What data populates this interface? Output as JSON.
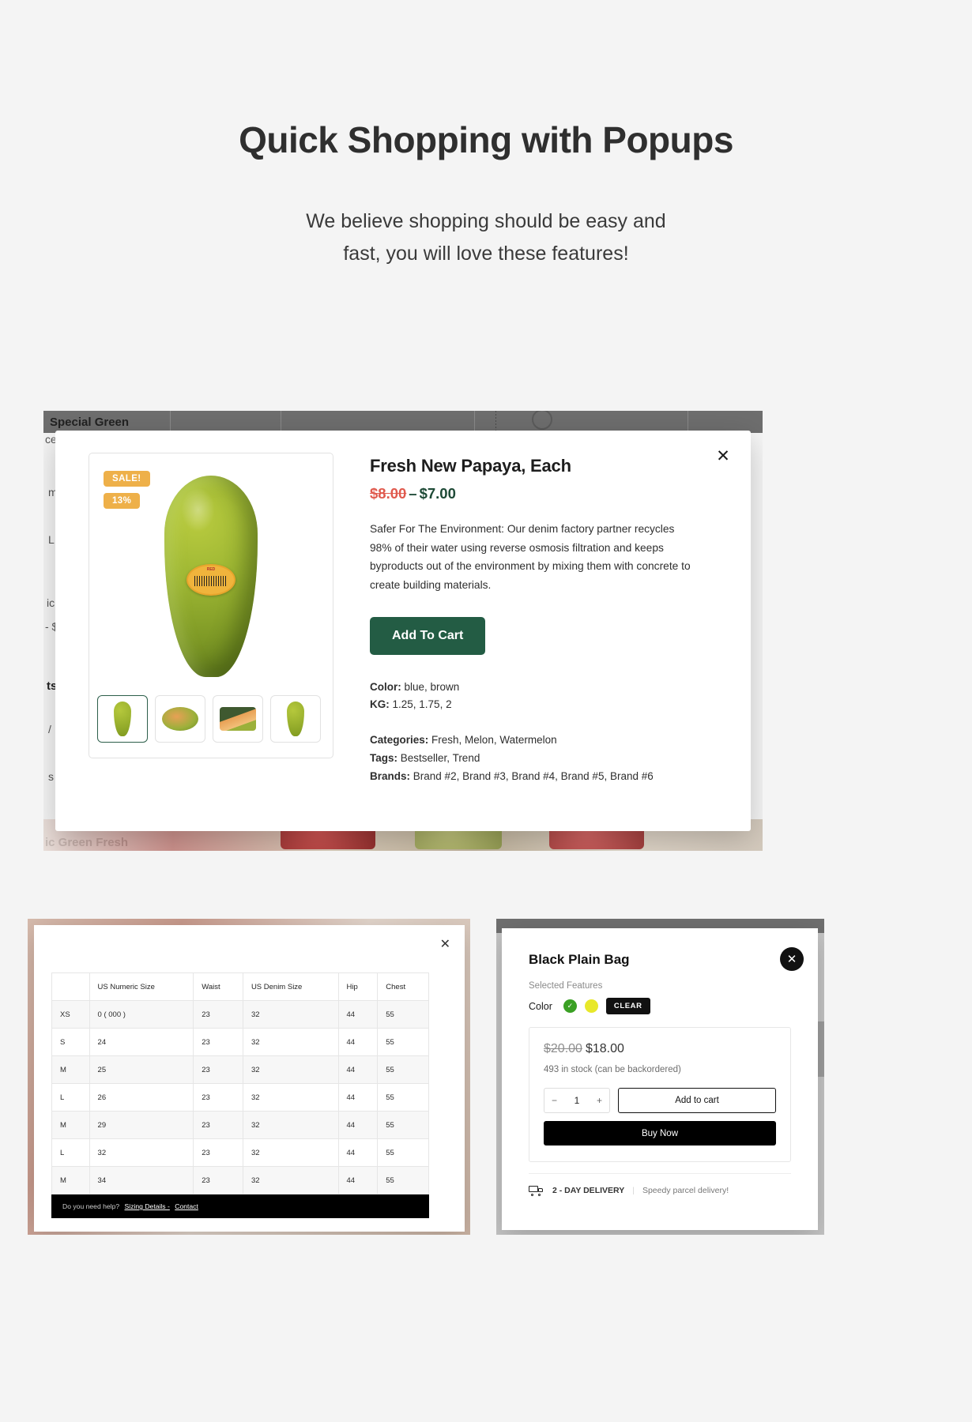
{
  "hero": {
    "title": "Quick Shopping with Popups",
    "subtitle_line1": "We believe shopping should be easy and",
    "subtitle_line2": "fast, you will love these features!"
  },
  "colors": {
    "accent_green": "#235c44",
    "sale_badge": "#eeb049",
    "old_price_red": "#e05a4e",
    "new_price_green": "#1e4a36",
    "black": "#000000"
  },
  "quick_view": {
    "close_label": "✕",
    "badges": {
      "sale": "SALE!",
      "discount": "13%"
    },
    "thumbnails": [
      {
        "name": "whole-papaya"
      },
      {
        "name": "cut-papaya"
      },
      {
        "name": "papaya-on-board"
      },
      {
        "name": "papaya-side"
      }
    ],
    "title": "Fresh New Papaya, Each",
    "price_old": "$8.00",
    "price_separator": "–",
    "price_new": "$7.00",
    "description": "Safer For The Environment: Our denim factory partner recycles 98% of their water using reverse osmosis filtration and keeps byproducts out of the environment by mixing them with concrete to create building materials.",
    "add_to_cart_label": "Add To Cart",
    "attributes": [
      {
        "label": "Color:",
        "value": "blue, brown"
      },
      {
        "label": "KG:",
        "value": "1.25, 1.75, 2"
      }
    ],
    "meta": [
      {
        "label": "Categories:",
        "value": "Fresh, Melon, Watermelon"
      },
      {
        "label": "Tags:",
        "value": "Bestseller, Trend"
      },
      {
        "label": "Brands:",
        "value": "Brand #2, Brand #3, Brand #4, Brand #5, Brand #6"
      }
    ],
    "background_texts": [
      "Special Green",
      "ce",
      "m",
      "L",
      "ic",
      "- $",
      "ts",
      "/",
      "s",
      "ic Green Fresh"
    ]
  },
  "size_chart": {
    "close_label": "✕",
    "columns": [
      "",
      "US Numeric Size",
      "Waist",
      "US Denim Size",
      "Hip",
      "Chest"
    ],
    "rows": [
      [
        "XS",
        "0 ( 000 )",
        "23",
        "32",
        "44",
        "55"
      ],
      [
        "S",
        "24",
        "23",
        "32",
        "44",
        "55"
      ],
      [
        "M",
        "25",
        "23",
        "32",
        "44",
        "55"
      ],
      [
        "L",
        "26",
        "23",
        "32",
        "44",
        "55"
      ],
      [
        "M",
        "29",
        "23",
        "32",
        "44",
        "55"
      ],
      [
        "L",
        "32",
        "23",
        "32",
        "44",
        "55"
      ],
      [
        "M",
        "34",
        "23",
        "32",
        "44",
        "55"
      ]
    ],
    "footer_text": "Do you need help?",
    "footer_link_1": "Sizing Details -",
    "footer_link_2": "Contact"
  },
  "bag_popup": {
    "close_label": "✕",
    "title": "Black Plain Bag",
    "selected_features_label": "Selected Features",
    "color_label": "Color",
    "swatches": [
      {
        "name": "green-swatch",
        "hex": "#3aa024",
        "selected": true,
        "check": "✓"
      },
      {
        "name": "yellow-swatch",
        "hex": "#e8e82a",
        "selected": false,
        "check": ""
      }
    ],
    "clear_label": "CLEAR",
    "price_old": "$20.00",
    "price_new": "$18.00",
    "stock_text": "493 in stock (can be backordered)",
    "qty_minus": "−",
    "qty_value": "1",
    "qty_plus": "+",
    "add_to_cart_label": "Add to cart",
    "buy_now_label": "Buy Now",
    "delivery_title": "2 - DAY DELIVERY",
    "delivery_divider": "|",
    "delivery_note": "Speedy parcel delivery!"
  }
}
